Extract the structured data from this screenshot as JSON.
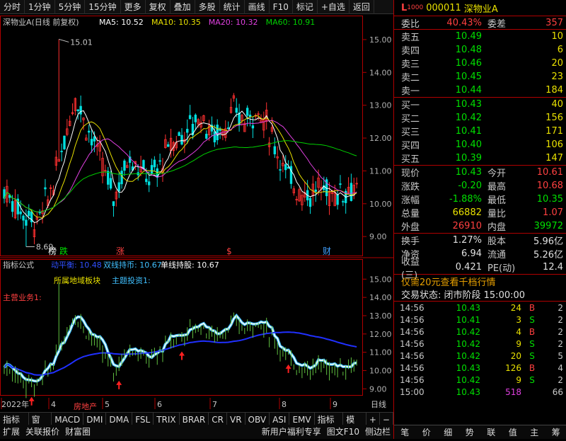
{
  "toolbar": {
    "items": [
      "分时",
      "1分钟",
      "5分钟",
      "15分钟",
      "更多",
      "复权",
      "叠加",
      "多股",
      "统计",
      "画线",
      "F10",
      "标记",
      "+自选",
      "返回"
    ]
  },
  "main_chart": {
    "title": "深物业A(日线 前复权)",
    "ma": [
      {
        "label": "MA5: 10.52",
        "color": "#ffffff"
      },
      {
        "label": "MA10: 10.35",
        "color": "#e8e000"
      },
      {
        "label": "MA20: 10.32",
        "color": "#e040e0"
      },
      {
        "label": "MA60: 10.91",
        "color": "#00d000"
      }
    ],
    "high_label": "15.01",
    "low_label": "8.69",
    "y_ticks": [
      "15.00",
      "14.00",
      "13.00",
      "12.00",
      "11.00",
      "10.00",
      "9.00"
    ],
    "markers": [
      {
        "text": "榜",
        "color": "#ffffff"
      },
      {
        "text": "跌",
        "color": "#00e000"
      },
      {
        "text": "涨",
        "color": "#ff4040"
      },
      {
        "text": "$",
        "color": "#ff4040"
      },
      {
        "text": "财",
        "color": "#40a0ff"
      }
    ]
  },
  "indicator": {
    "title": "指标公式",
    "lines": [
      {
        "label": "动平衡: 10.48",
        "color": "#3050ff"
      },
      {
        "label": "双线持币: 10.67",
        "color": "#40c0ff"
      },
      {
        "label": "单线持股: 10.67",
        "color": "#ffffff"
      }
    ],
    "row2": [
      {
        "label": "主营业务1:",
        "color": "#ff4040"
      },
      {
        "label": "所属地域板块",
        "color": "#e8e000"
      },
      {
        "label": "主题投资1:",
        "color": "#40c0ff"
      }
    ],
    "annotation": "房地产",
    "y_ticks": [
      "15.00",
      "14.00",
      "13.00",
      "12.00",
      "11.00",
      "10.00",
      "9.00"
    ]
  },
  "x_axis": {
    "labels": [
      "2022年",
      "4",
      "5",
      "6",
      "7",
      "8",
      "9"
    ],
    "period": "日线"
  },
  "tabs": [
    "指标A",
    "窗口",
    "MACD",
    "DMI",
    "DMA",
    "FSL",
    "TRIX",
    "BRAR",
    "CR",
    "VR",
    "OBV",
    "ASI",
    "EMV",
    "指标B",
    "模板",
    "+",
    "−"
  ],
  "footer": {
    "left": [
      "扩展",
      "关联报价",
      "财富圈"
    ],
    "right": [
      "新用户福利专享",
      "图文F10",
      "侧边栏"
    ]
  },
  "quote": {
    "code": "000011",
    "name": "深物业A",
    "weibi_label": "委比",
    "weibi": "40.43%",
    "weicha_label": "委差",
    "weicha": "357",
    "asks": [
      {
        "label": "卖五",
        "price": "10.49",
        "vol": "10"
      },
      {
        "label": "卖四",
        "price": "10.48",
        "vol": "6"
      },
      {
        "label": "卖三",
        "price": "10.46",
        "vol": "20"
      },
      {
        "label": "卖二",
        "price": "10.45",
        "vol": "23"
      },
      {
        "label": "卖一",
        "price": "10.44",
        "vol": "184"
      }
    ],
    "bids": [
      {
        "label": "买一",
        "price": "10.43",
        "vol": "40"
      },
      {
        "label": "买二",
        "price": "10.42",
        "vol": "156"
      },
      {
        "label": "买三",
        "price": "10.41",
        "vol": "171"
      },
      {
        "label": "买四",
        "price": "10.40",
        "vol": "106"
      },
      {
        "label": "买五",
        "price": "10.39",
        "vol": "147"
      }
    ],
    "stats1": [
      {
        "l1": "现价",
        "v1": "10.43",
        "c1": "green",
        "l2": "今开",
        "v2": "10.61",
        "c2": "red"
      },
      {
        "l1": "涨跌",
        "v1": "-0.20",
        "c1": "green",
        "l2": "最高",
        "v2": "10.68",
        "c2": "red"
      },
      {
        "l1": "涨幅",
        "v1": "-1.88%",
        "c1": "green",
        "l2": "最低",
        "v2": "10.35",
        "c2": "green"
      },
      {
        "l1": "总量",
        "v1": "66882",
        "c1": "yellow",
        "l2": "量比",
        "v2": "1.07",
        "c2": "red"
      },
      {
        "l1": "外盘",
        "v1": "26910",
        "c1": "red",
        "l2": "内盘",
        "v2": "39972",
        "c2": "green"
      }
    ],
    "stats2": [
      {
        "l1": "换手",
        "v1": "1.27%",
        "l2": "股本",
        "v2": "5.96亿"
      },
      {
        "l1": "净资",
        "v1": "6.94",
        "l2": "流通",
        "v2": "5.26亿"
      },
      {
        "l1": "收益(三)",
        "v1": "0.421",
        "l2": "PE(动)",
        "v2": "12.4"
      }
    ],
    "promo": "仅需20元查看千档行情",
    "status": "交易状态: 闭市阶段 15:00:00",
    "trades": [
      {
        "t": "14:56",
        "p": "10.43",
        "pc": "green",
        "v": "24",
        "vc": "yellow",
        "d": "B",
        "dc": "red",
        "n": "2"
      },
      {
        "t": "14:56",
        "p": "10.41",
        "pc": "green",
        "v": "3",
        "vc": "yellow",
        "d": "S",
        "dc": "green",
        "n": "2"
      },
      {
        "t": "14:56",
        "p": "10.42",
        "pc": "green",
        "v": "4",
        "vc": "yellow",
        "d": "B",
        "dc": "red",
        "n": "2"
      },
      {
        "t": "14:56",
        "p": "10.42",
        "pc": "green",
        "v": "9",
        "vc": "yellow",
        "d": "S",
        "dc": "green",
        "n": "2"
      },
      {
        "t": "14:56",
        "p": "10.42",
        "pc": "green",
        "v": "20",
        "vc": "yellow",
        "d": "S",
        "dc": "green",
        "n": "5"
      },
      {
        "t": "14:56",
        "p": "10.43",
        "pc": "green",
        "v": "126",
        "vc": "yellow",
        "d": "B",
        "dc": "red",
        "n": "4"
      },
      {
        "t": "14:56",
        "p": "10.42",
        "pc": "green",
        "v": "9",
        "vc": "yellow",
        "d": "S",
        "dc": "green",
        "n": "2"
      },
      {
        "t": "15:00",
        "p": "10.43",
        "pc": "green",
        "v": "518",
        "vc": "magenta",
        "d": "",
        "dc": "white",
        "n": "66"
      }
    ],
    "footer_tabs": [
      "笔",
      "价",
      "细",
      "势",
      "联",
      "值",
      "主",
      "筹"
    ]
  }
}
